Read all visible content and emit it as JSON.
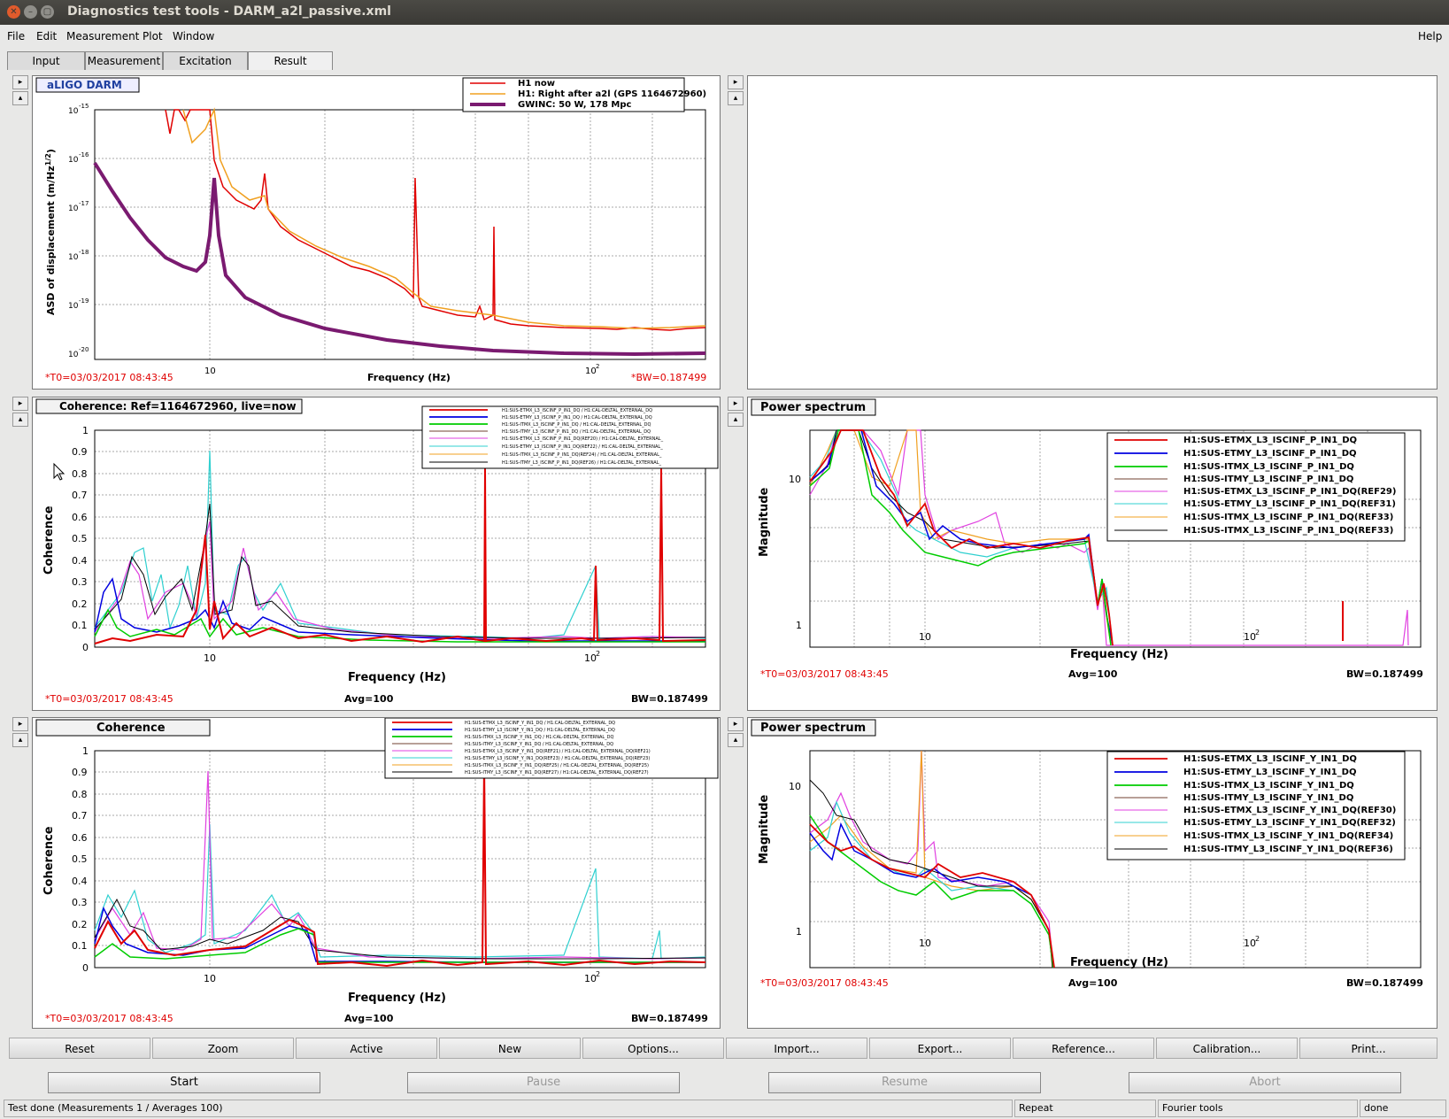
{
  "window": {
    "title": "Diagnostics test tools - DARM_a2l_passive.xml"
  },
  "menu": {
    "items": [
      "File",
      "Edit",
      "Measurement",
      "Plot",
      "Window"
    ],
    "help": "Help"
  },
  "tabs": [
    "Input",
    "Measurement",
    "Excitation",
    "Result"
  ],
  "colors": {
    "red": "#e00000",
    "orange": "#f0a020",
    "purple": "#7a1a70",
    "blue": "#0000e0",
    "green": "#00cc00",
    "brown": "#704030",
    "magenta": "#e040e0",
    "cyan": "#30d0d0",
    "black": "#000000",
    "redtext": "#e00000"
  },
  "pads": {
    "darm": {
      "tag": "aLIGO DARM",
      "ylabel": "ASD of displacement (m/Hz",
      "ylabel_sup": "1/2",
      "ylabel_end": ")",
      "xlabel": "Frequency (Hz)",
      "t0": "*T0=03/03/2017 08:43:45",
      "bw": "*BW=0.187499",
      "legend": [
        "H1 now",
        "H1: Right after a2l (GPS 1164672960)",
        "GWINC: 50 W, 178 Mpc"
      ],
      "yticks": [
        "10",
        "10",
        "10",
        "10",
        "10",
        "10"
      ],
      "yexps": [
        "-15",
        "-16",
        "-17",
        "-18",
        "-19",
        "-20"
      ],
      "xticks": [
        "10",
        "10"
      ],
      "xexps": [
        "",
        "2"
      ]
    },
    "coh1": {
      "tag": "Coherence: Ref=1164672960, live=now",
      "ylabel": "Coherence",
      "xlabel": "Frequency (Hz)",
      "t0": "*T0=03/03/2017 08:43:45",
      "avg": "Avg=100",
      "bw": "BW=0.187499",
      "yticks": [
        "1",
        "0.9",
        "0.8",
        "0.7",
        "0.6",
        "0.5",
        "0.4",
        "0.3",
        "0.2",
        "0.1",
        "0"
      ],
      "xticks": [
        "10",
        "10"
      ],
      "xexps": [
        "",
        "2"
      ],
      "legend": [
        "H1:SUS-ETMX_L3_ISCINF_P_IN1_DQ / H1:CAL-DELTAL_EXTERNAL_DQ",
        "H1:SUS-ETMY_L3_ISCINF_P_IN1_DQ / H1:CAL-DELTAL_EXTERNAL_DQ",
        "H1:SUS-ITMX_L3_ISCINF_P_IN1_DQ / H1:CAL-DELTAL_EXTERNAL_DQ",
        "H1:SUS-ITMY_L3_ISCINF_P_IN1_DQ / H1:CAL-DELTAL_EXTERNAL_DQ",
        "H1:SUS-ETMX_L3_ISCINF_P_IN1_DQ(REF20) / H1:CAL-DELTAL_EXTERNAL_",
        "H1:SUS-ETMY_L3_ISCINF_P_IN1_DQ(REF22) / H1:CAL-DELTAL_EXTERNAL_",
        "H1:SUS-ITMX_L3_ISCINF_P_IN1_DQ(REF24) / H1:CAL-DELTAL_EXTERNAL_",
        "H1:SUS-ITMY_L3_ISCINF_P_IN1_DQ(REF26) / H1:CAL-DELTAL_EXTERNAL_"
      ]
    },
    "ps1": {
      "tag": "Power spectrum",
      "ylabel": "Magnitude",
      "xlabel": "Frequency (Hz)",
      "t0": "*T0=03/03/2017 08:43:45",
      "avg": "Avg=100",
      "bw": "BW=0.187499",
      "yticks": [
        "10",
        "1"
      ],
      "xticks": [
        "10",
        "10"
      ],
      "xexps": [
        "",
        "2"
      ],
      "legend": [
        "H1:SUS-ETMX_L3_ISCINF_P_IN1_DQ",
        "H1:SUS-ETMY_L3_ISCINF_P_IN1_DQ",
        "H1:SUS-ITMX_L3_ISCINF_P_IN1_DQ",
        "H1:SUS-ITMY_L3_ISCINF_P_IN1_DQ",
        "H1:SUS-ETMX_L3_ISCINF_P_IN1_DQ(REF29)",
        "H1:SUS-ETMY_L3_ISCINF_P_IN1_DQ(REF31)",
        "H1:SUS-ITMX_L3_ISCINF_P_IN1_DQ(REF33)",
        "H1:SUS-ITMX_L3_ISCINF_P_IN1_DQ(REF33)"
      ]
    },
    "coh2": {
      "tag": "Coherence",
      "ylabel": "Coherence",
      "xlabel": "Frequency (Hz)",
      "t0": "*T0=03/03/2017 08:43:45",
      "avg": "Avg=100",
      "bw": "BW=0.187499",
      "yticks": [
        "1",
        "0.9",
        "0.8",
        "0.7",
        "0.6",
        "0.5",
        "0.4",
        "0.3",
        "0.2",
        "0.1",
        "0"
      ],
      "xticks": [
        "10",
        "10"
      ],
      "xexps": [
        "",
        "2"
      ],
      "legend": [
        "H1:SUS-ETMX_L3_ISCINF_Y_IN1_DQ / H1:CAL-DELTAL_EXTERNAL_DQ",
        "H1:SUS-ETMY_L3_ISCINF_Y_IN1_DQ / H1:CAL-DELTAL_EXTERNAL_DQ",
        "H1:SUS-ITMX_L3_ISCINF_Y_IN1_DQ / H1:CAL-DELTAL_EXTERNAL_DQ",
        "H1:SUS-ITMY_L3_ISCINF_Y_IN1_DQ / H1:CAL-DELTAL_EXTERNAL_DQ",
        "H1:SUS-ETMX_L3_ISCINF_Y_IN1_DQ(REF21) / H1:CAL-DELTAL_EXTERNAL_DQ(REF21)",
        "H1:SUS-ETMY_L3_ISCINF_Y_IN1_DQ(REF23) / H1:CAL-DELTAL_EXTERNAL_DQ(REF23)",
        "H1:SUS-ITMX_L3_ISCINF_Y_IN1_DQ(REF25) / H1:CAL-DELTAL_EXTERNAL_DQ(REF25)",
        "H1:SUS-ITMY_L3_ISCINF_Y_IN1_DQ(REF27) / H1:CAL-DELTAL_EXTERNAL_DQ(REF27)"
      ]
    },
    "ps2": {
      "tag": "Power spectrum",
      "ylabel": "Magnitude",
      "xlabel": "Frequency (Hz)",
      "t0": "*T0=03/03/2017 08:43:45",
      "avg": "Avg=100",
      "bw": "BW=0.187499",
      "yticks": [
        "10",
        "1"
      ],
      "xticks": [
        "10",
        "10"
      ],
      "xexps": [
        "",
        "2"
      ],
      "legend": [
        "H1:SUS-ETMX_L3_ISCINF_Y_IN1_DQ",
        "H1:SUS-ETMY_L3_ISCINF_Y_IN1_DQ",
        "H1:SUS-ITMX_L3_ISCINF_Y_IN1_DQ",
        "H1:SUS-ITMY_L3_ISCINF_Y_IN1_DQ",
        "H1:SUS-ETMX_L3_ISCINF_Y_IN1_DQ(REF30)",
        "H1:SUS-ETMY_L3_ISCINF_Y_IN1_DQ(REF32)",
        "H1:SUS-ITMX_L3_ISCINF_Y_IN1_DQ(REF34)",
        "H1:SUS-ITMY_L3_ISCINF_Y_IN1_DQ(REF36)"
      ]
    }
  },
  "toolbar": [
    "Reset",
    "Zoom",
    "Active",
    "New",
    "Options...",
    "Import...",
    "Export...",
    "Reference...",
    "Calibration...",
    "Print..."
  ],
  "controls": {
    "start": "Start",
    "pause": "Pause",
    "resume": "Resume",
    "abort": "Abort"
  },
  "status": {
    "main": "Test done (Measurements 1 / Averages 100)",
    "repeat": "Repeat",
    "tool": "Fourier tools",
    "state": "done"
  }
}
